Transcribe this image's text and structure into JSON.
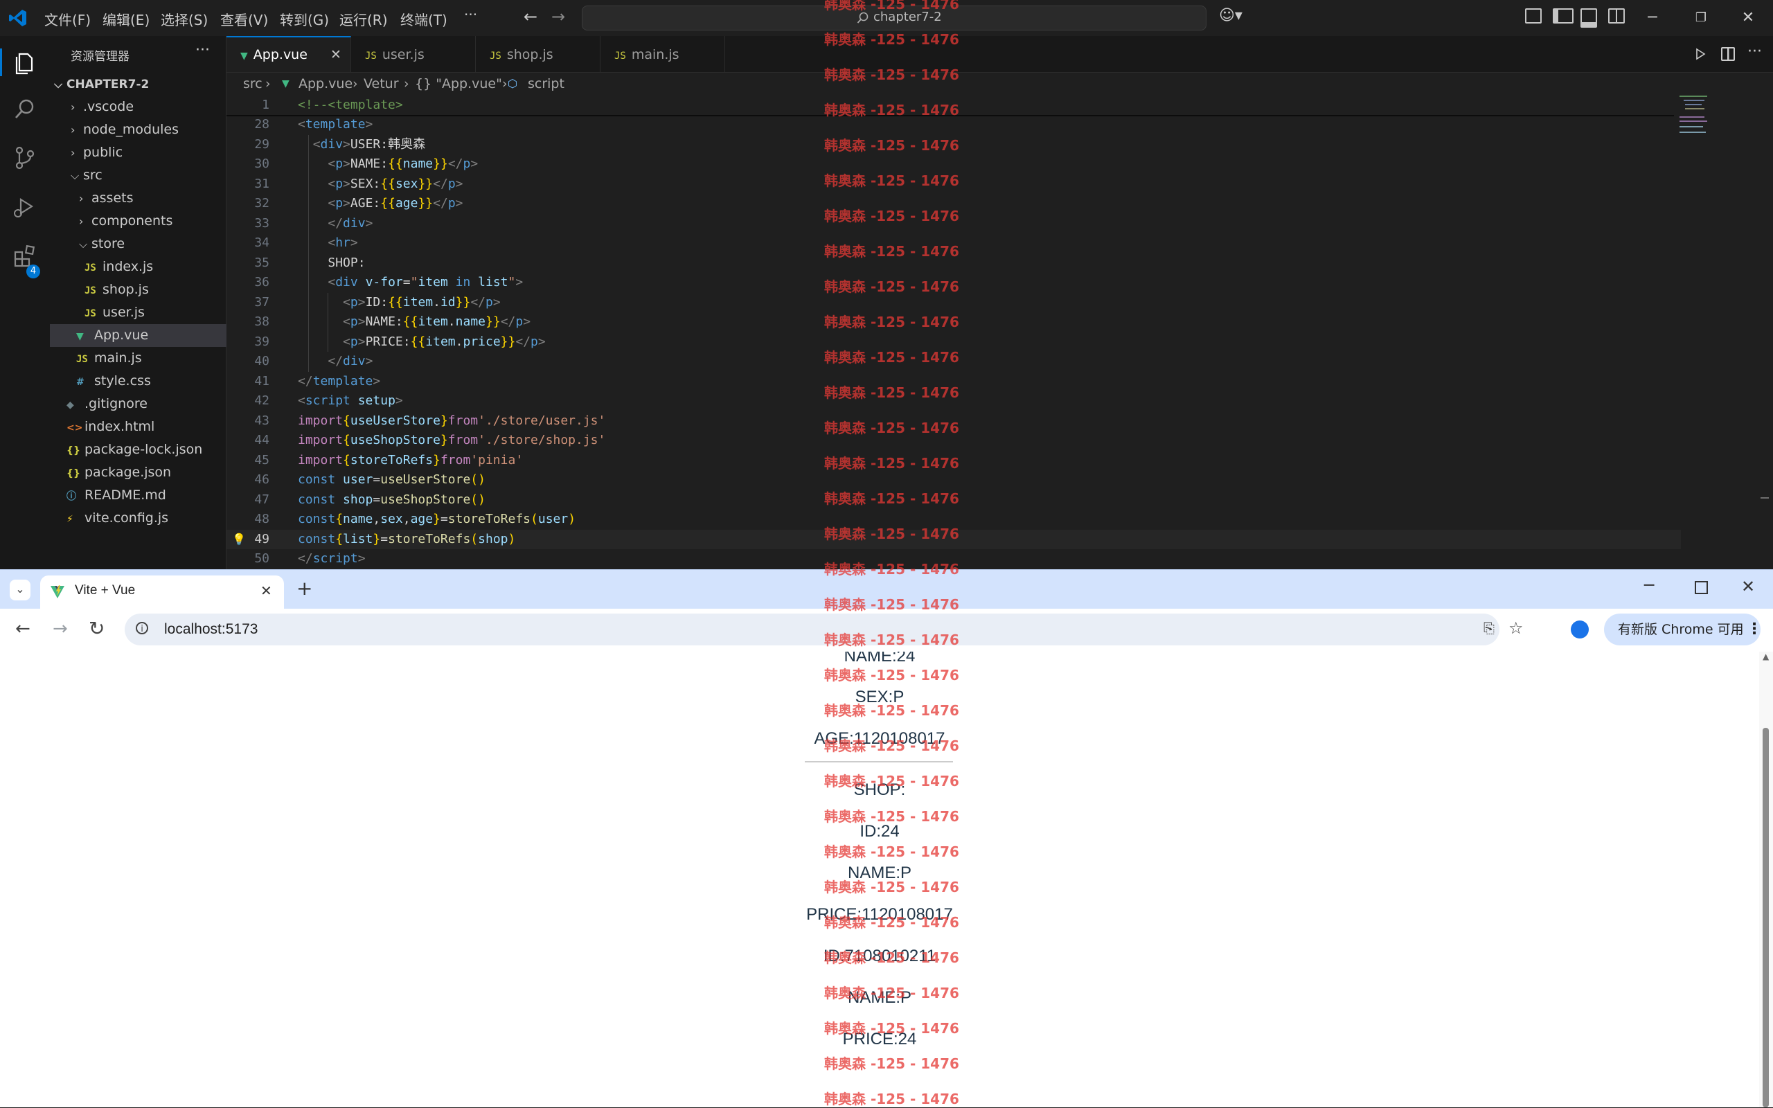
{
  "vscode": {
    "menu": [
      "文件(F)",
      "编辑(E)",
      "选择(S)",
      "查看(V)",
      "转到(G)",
      "运行(R)",
      "终端(T)",
      "···"
    ],
    "search_text": "chapter7-2",
    "explorer_title": "资源管理器",
    "extensions_badge": "4",
    "tree": [
      {
        "label": "CHAPTER7-2",
        "type": "root"
      },
      {
        "label": ".vscode",
        "type": "folder"
      },
      {
        "label": "node_modules",
        "type": "folder"
      },
      {
        "label": "public",
        "type": "folder"
      },
      {
        "label": "src",
        "type": "folder-open"
      },
      {
        "label": "assets",
        "type": "folder"
      },
      {
        "label": "components",
        "type": "folder"
      },
      {
        "label": "store",
        "type": "folder-open"
      },
      {
        "label": "index.js",
        "type": "js"
      },
      {
        "label": "shop.js",
        "type": "js"
      },
      {
        "label": "user.js",
        "type": "js"
      },
      {
        "label": "App.vue",
        "type": "vue"
      },
      {
        "label": "main.js",
        "type": "js"
      },
      {
        "label": "style.css",
        "type": "css"
      },
      {
        "label": ".gitignore",
        "type": "git"
      },
      {
        "label": "index.html",
        "type": "html"
      },
      {
        "label": "package-lock.json",
        "type": "json"
      },
      {
        "label": "package.json",
        "type": "json"
      },
      {
        "label": "README.md",
        "type": "info"
      },
      {
        "label": "vite.config.js",
        "type": "vite"
      }
    ],
    "tabs": [
      "App.vue",
      "user.js",
      "shop.js",
      "main.js"
    ],
    "breadcrumb": [
      "src",
      "App.vue",
      "Vetur",
      "{} \"App.vue\"",
      "script"
    ],
    "line_numbers": [
      "1",
      "28",
      "29",
      "30",
      "31",
      "32",
      "33",
      "34",
      "35",
      "36",
      "37",
      "38",
      "39",
      "40",
      "41",
      "42",
      "43",
      "44",
      "45",
      "46",
      "47",
      "48",
      "49",
      "50"
    ]
  },
  "chrome": {
    "tab_title": "Vite + Vue",
    "url": "localhost:5173",
    "update_label": "有新版 Chrome 可用",
    "page_lines": [
      "NAME:24",
      "SEX:P",
      "AGE:1120108017",
      "SHOP:",
      "ID:24",
      "NAME:P",
      "PRICE:1120108017",
      "ID:7108010211",
      "NAME:P",
      "PRICE:24"
    ]
  },
  "watermark": "韩奥森 -125 - 1476",
  "colors": {
    "accent": "#0078d4",
    "watermark": "#e53935",
    "vue_green": "#41b883"
  }
}
